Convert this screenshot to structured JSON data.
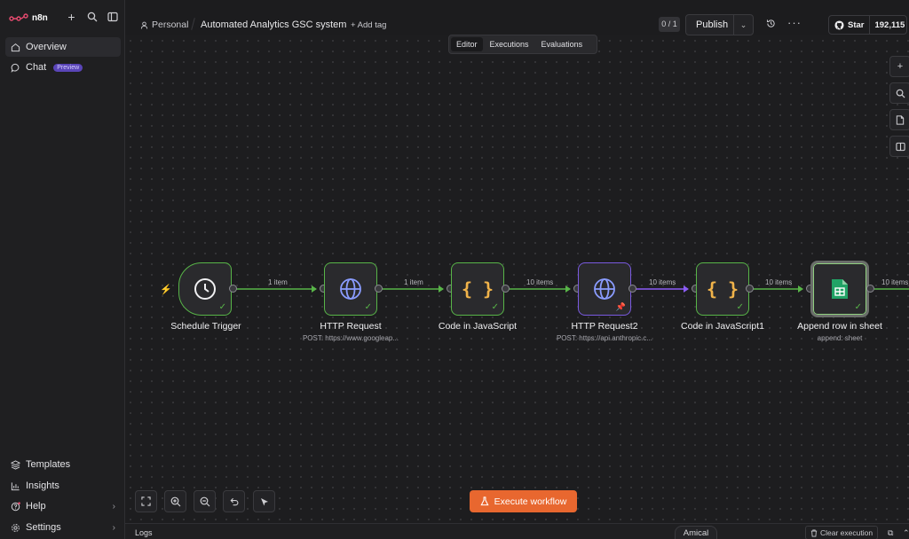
{
  "app": {
    "name": "n8n",
    "brand_color": "#ea4b71",
    "accent_color": "#e8672f",
    "success_color": "#58b548",
    "pinned_color": "#7a5ae0"
  },
  "sidebar": {
    "top_items": [
      {
        "label": "Overview",
        "icon": "home-icon",
        "active": true
      },
      {
        "label": "Chat",
        "icon": "chat-icon",
        "badge": "Preview"
      }
    ],
    "bottom_items": [
      {
        "label": "Templates",
        "icon": "templates-icon"
      },
      {
        "label": "Insights",
        "icon": "insights-icon"
      },
      {
        "label": "Help",
        "icon": "help-icon"
      },
      {
        "label": "Settings",
        "icon": "gear-icon"
      }
    ]
  },
  "header": {
    "project": "Personal",
    "workflow_title": "Automated Analytics GSC system",
    "add_tag": "+ Add tag",
    "counter": "0 / 1",
    "publish_label": "Publish",
    "github_star_label": "Star",
    "github_star_count": "192,115"
  },
  "tabs": [
    "Editor",
    "Executions",
    "Evaluations"
  ],
  "nodes": [
    {
      "label": "Schedule Trigger",
      "sub": "",
      "icon": "clock-icon"
    },
    {
      "label": "HTTP Request",
      "sub": "POST: https://www.googleap...",
      "icon": "globe-icon"
    },
    {
      "label": "Code in JavaScript",
      "sub": "",
      "icon": "code-braces-icon"
    },
    {
      "label": "HTTP Request2",
      "sub": "POST: https://api.anthropic.c...",
      "icon": "globe-icon"
    },
    {
      "label": "Code in JavaScript1",
      "sub": "",
      "icon": "code-braces-icon"
    },
    {
      "label": "Append row in sheet",
      "sub": "append: sheet",
      "icon": "google-sheets-icon"
    }
  ],
  "edges": [
    "1 item",
    "1 item",
    "10 items",
    "10 items",
    "10 items",
    "10 items"
  ],
  "footer": {
    "execute_label": "Execute workflow",
    "logs_label": "Logs",
    "amical_label": "Amical",
    "clear_label": "Clear execution"
  }
}
